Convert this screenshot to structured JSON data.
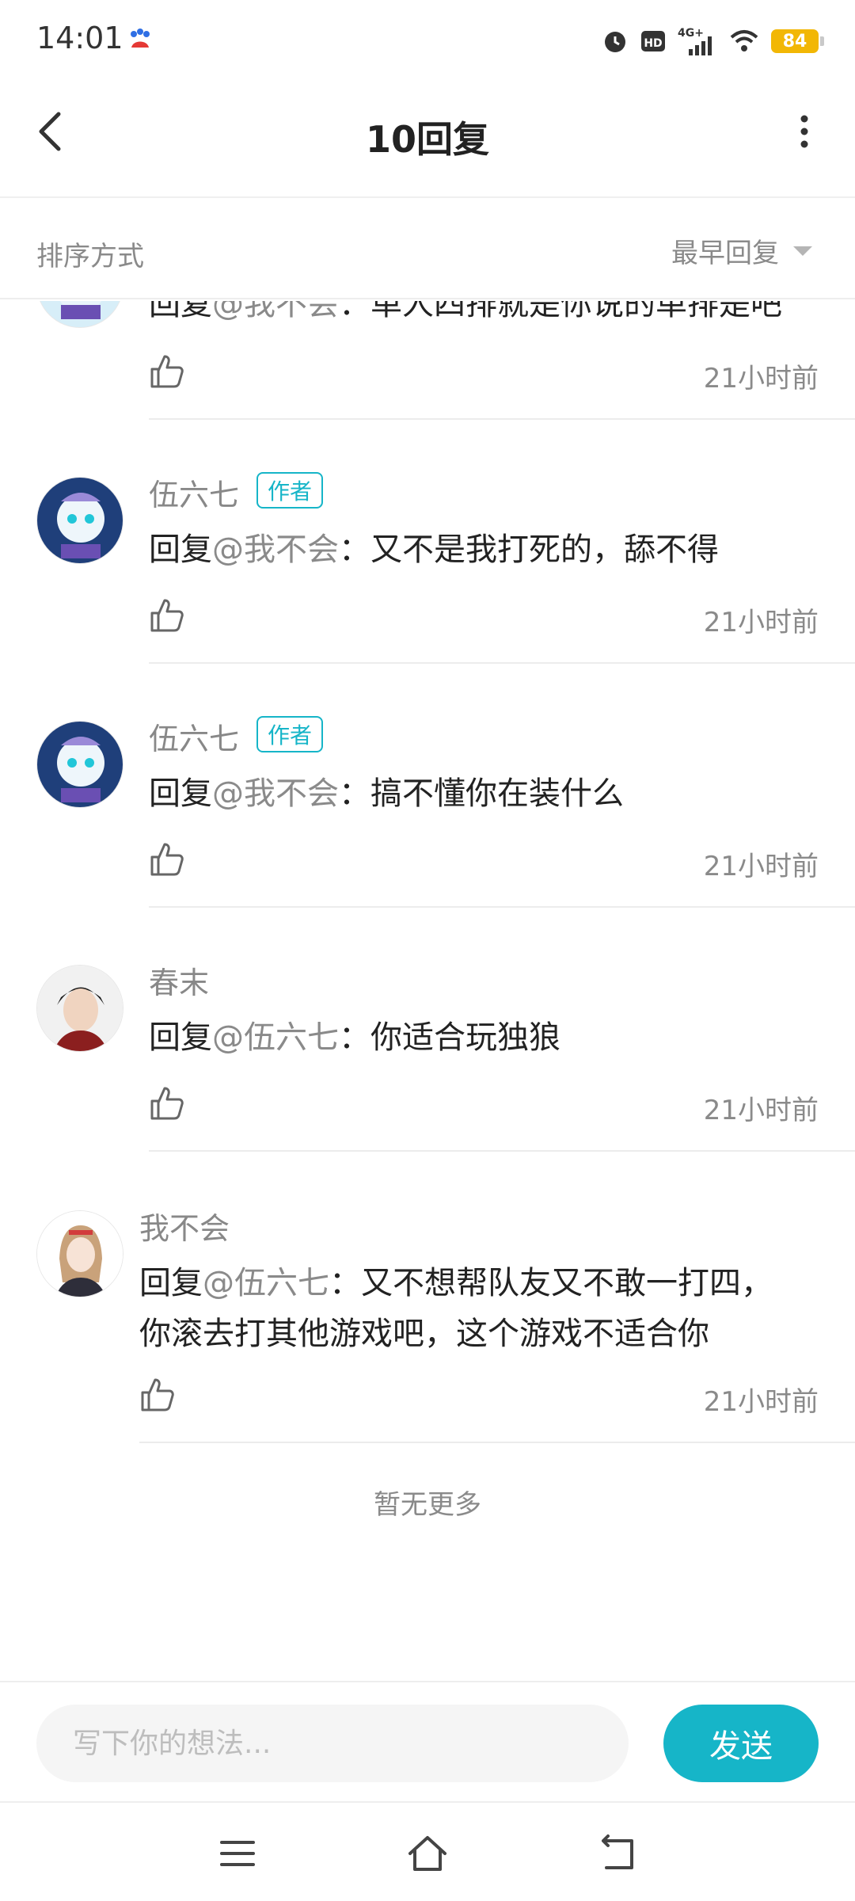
{
  "status_bar": {
    "time": "14:01",
    "battery": "84",
    "network": "4G+",
    "hd": "HD"
  },
  "header": {
    "title": "10回复"
  },
  "sort": {
    "label": "排序方式",
    "value": "最早回复"
  },
  "partial_reply": {
    "prefix": "回复",
    "mention": "@我不会",
    "separator": "：",
    "text": "单人四排就是你说的单排是吧",
    "time": "21小时前"
  },
  "replies": [
    {
      "name": "伍六七",
      "badge": "作者",
      "prefix": "回复",
      "mention": "@我不会",
      "separator": "：",
      "text": "又不是我打死的，舔不得",
      "time": "21小时前"
    },
    {
      "name": "伍六七",
      "badge": "作者",
      "prefix": "回复",
      "mention": "@我不会",
      "separator": "：",
      "text": "搞不懂你在装什么",
      "time": "21小时前"
    },
    {
      "name": "春末",
      "prefix": "回复",
      "mention": "@伍六七",
      "separator": "：",
      "text": "你适合玩独狼",
      "time": "21小时前"
    },
    {
      "name": "我不会",
      "prefix": "回复",
      "mention": "@伍六七",
      "separator": "：",
      "text": "又不想帮队友又不敢一打四，",
      "text2": "你滚去打其他游戏吧，这个游戏不适合你",
      "time": "21小时前"
    }
  ],
  "footer_note": "暂无更多",
  "input": {
    "placeholder": "写下你的想法...",
    "send_label": "发送"
  },
  "colors": {
    "accent": "#16b5c8",
    "battery": "#f2b705"
  }
}
